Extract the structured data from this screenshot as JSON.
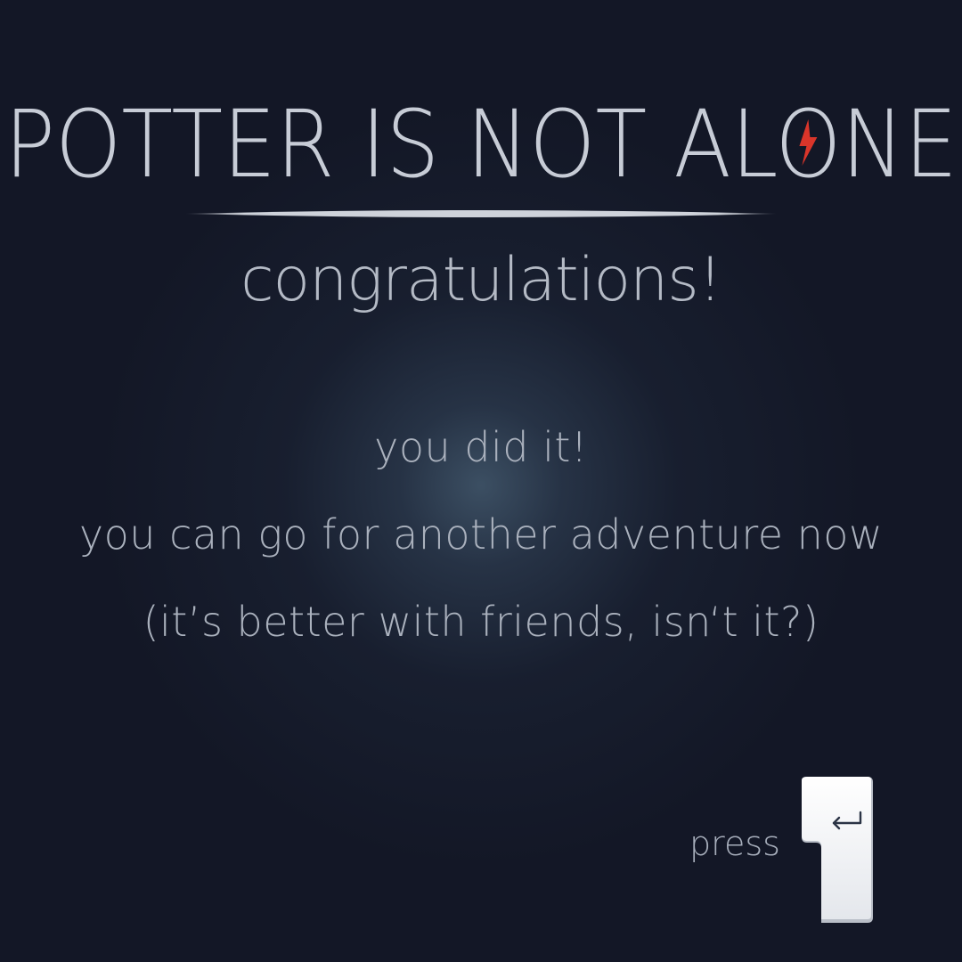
{
  "title": {
    "text_before": "POTTER IS NOT AL",
    "text_after": "NE",
    "bolt_icon": "lightning-bolt-in-o",
    "bolt_color": "#d9352a"
  },
  "subtitle": "congratulations!",
  "messages": [
    "you did it!",
    "you can go for another adventure now",
    "(it’s better with friends, isn‘t it?)"
  ],
  "prompt": {
    "label": "press",
    "key_icon": "enter-key-icon"
  },
  "colors": {
    "background": "#131726",
    "text": "#c7ccd6",
    "accent": "#d9352a"
  }
}
